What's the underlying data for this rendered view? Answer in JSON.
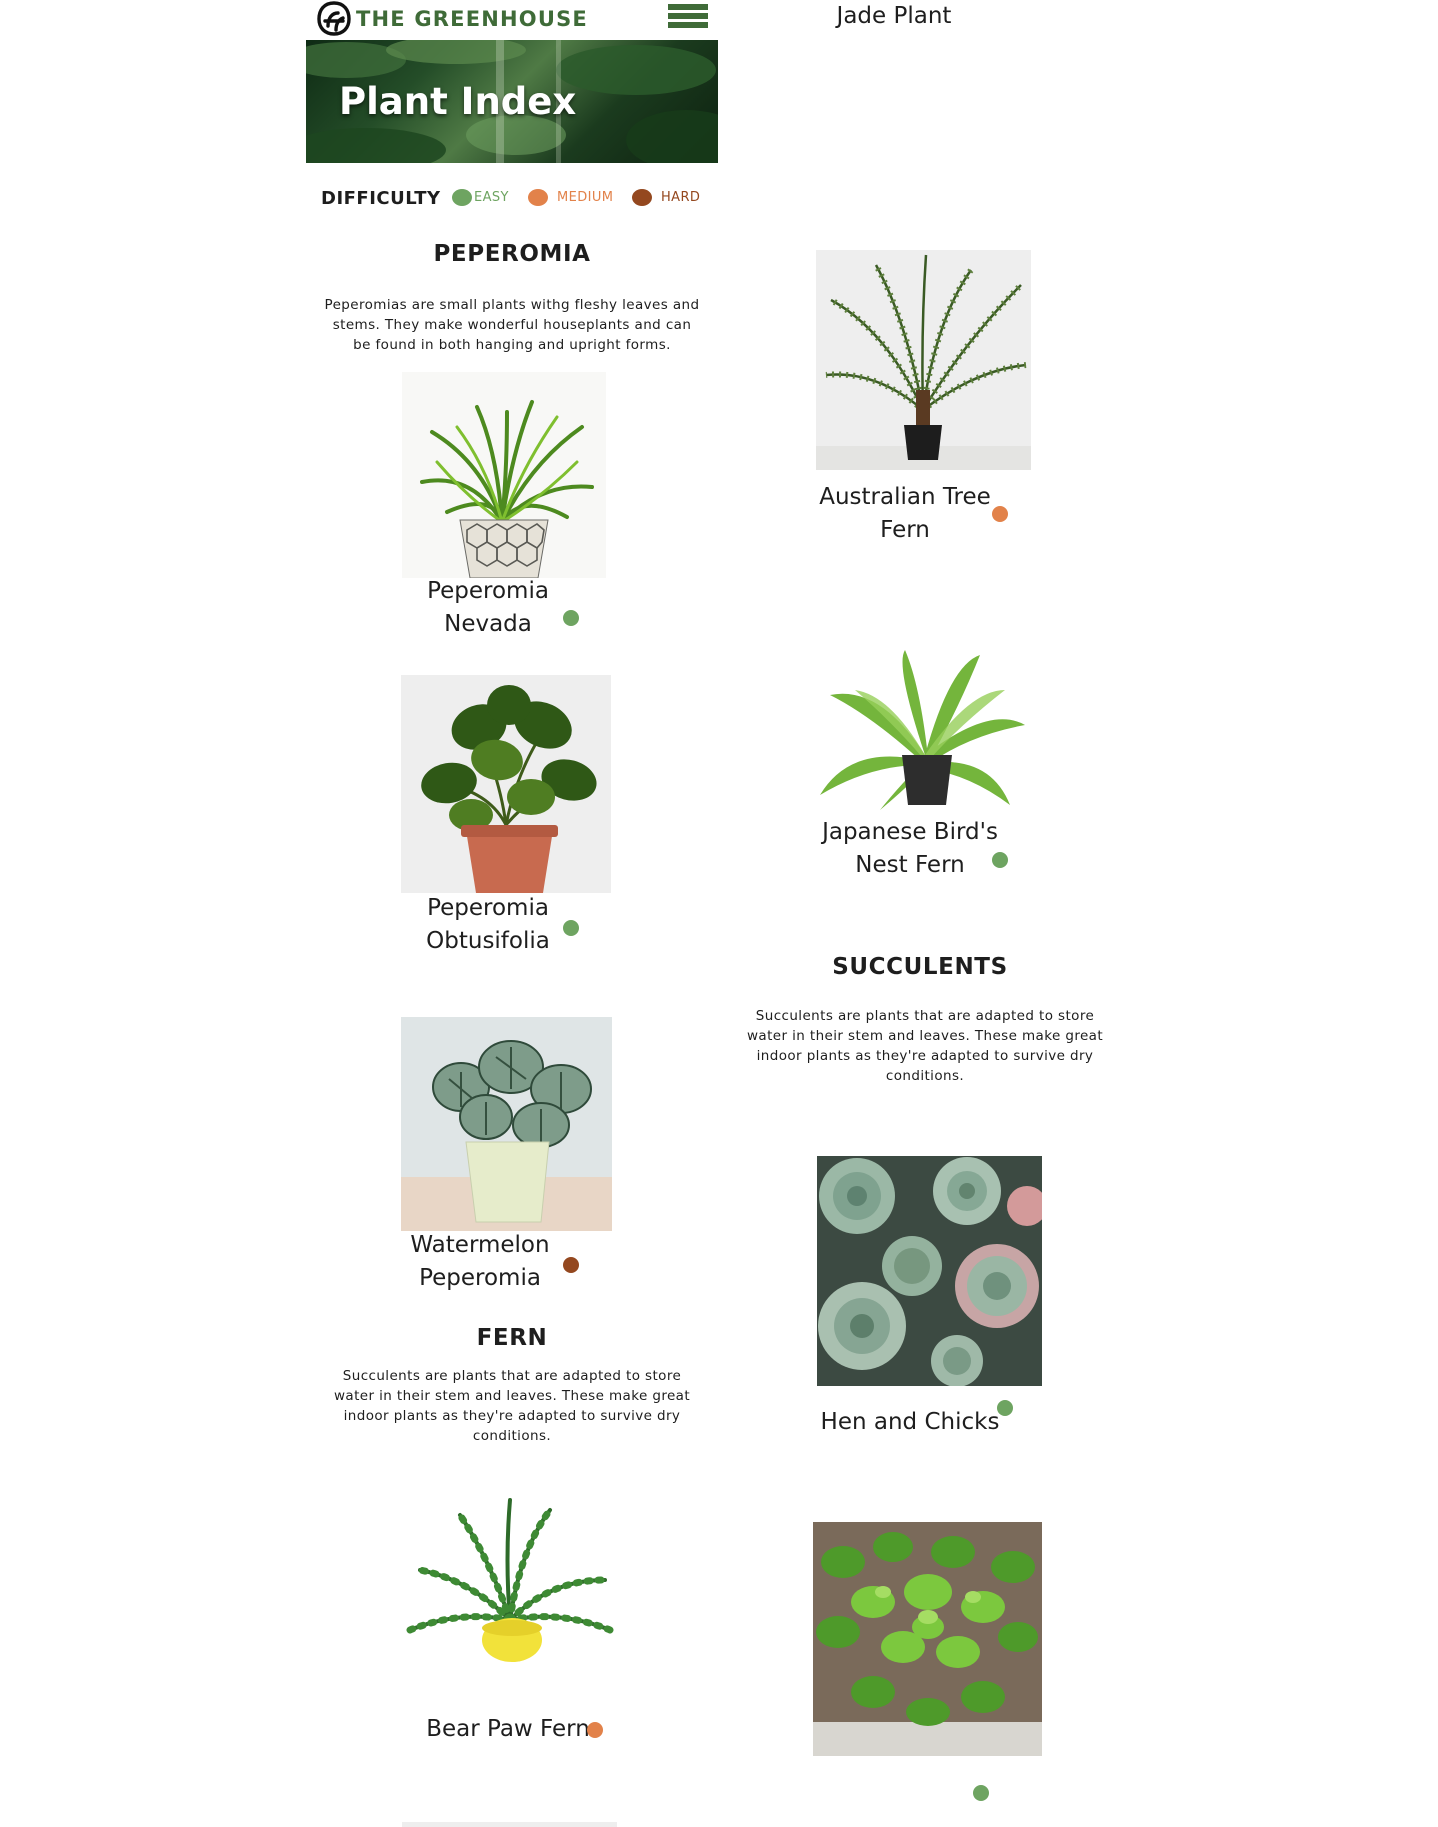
{
  "header": {
    "brand": "THE GREENHOUSE",
    "logo_icon": "greenhouse-monogram-icon",
    "menu_icon": "hamburger-menu-icon",
    "brand_color": "#3f6b38"
  },
  "hero": {
    "title": "Plant Index"
  },
  "legend": {
    "title": "DIFFICULTY",
    "levels": [
      {
        "label": "EASY",
        "color": "#6ea461"
      },
      {
        "label": "MEDIUM",
        "color": "#e2824a"
      },
      {
        "label": "HARD",
        "color": "#94481f"
      }
    ]
  },
  "sections": {
    "peperomia": {
      "title": "PEPEROMIA",
      "description": "Peperomias are small plants withg fleshy leaves and stems. They make wonderful houseplants and can be found in both hanging and upright forms."
    },
    "fern": {
      "title": "FERN",
      "description": "Succulents are plants that are adapted to store water in their stem and leaves. These make great indoor plants as they're adapted to survive dry conditions."
    },
    "succulents": {
      "title": "SUCCULENTS",
      "description": "Succulents are plants that are adapted to store water in their stem and leaves. These make great indoor plants as they're adapted to survive dry conditions."
    }
  },
  "plants": [
    {
      "name_line1": "Peperomia",
      "name_line2": "Nevada",
      "difficulty": "EASY",
      "color": "#6ea461"
    },
    {
      "name_line1": "Peperomia",
      "name_line2": "Obtusifolia",
      "difficulty": "EASY",
      "color": "#6ea461"
    },
    {
      "name_line1": "Watermelon",
      "name_line2": "Peperomia",
      "difficulty": "HARD",
      "color": "#94481f"
    },
    {
      "name_line1": "Bear Paw Fern",
      "name_line2": "",
      "difficulty": "MEDIUM",
      "color": "#e2824a"
    },
    {
      "name_line1": "Australian Tree",
      "name_line2": "Fern",
      "difficulty": "MEDIUM",
      "color": "#e2824a"
    },
    {
      "name_line1": "Japanese Bird's",
      "name_line2": "Nest Fern",
      "difficulty": "EASY",
      "color": "#6ea461"
    },
    {
      "name_line1": "Hen and Chicks",
      "name_line2": "",
      "difficulty": "EASY",
      "color": "#6ea461"
    },
    {
      "name_line1": "Jade Plant",
      "name_line2": "",
      "difficulty": "EASY",
      "color": "#6ea461"
    }
  ]
}
